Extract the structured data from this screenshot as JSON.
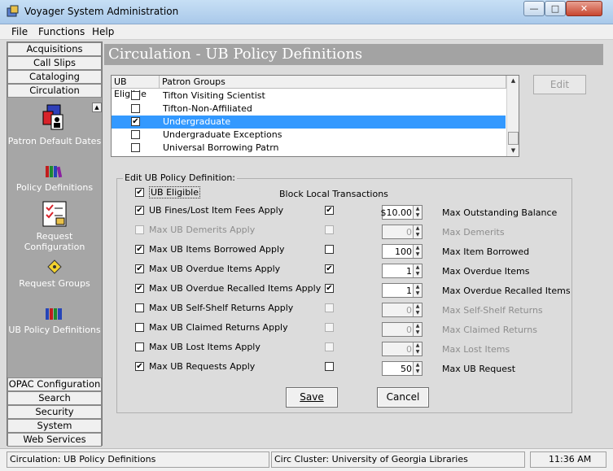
{
  "window": {
    "title": "Voyager System Administration"
  },
  "menu": [
    "File",
    "Functions",
    "Help"
  ],
  "nav": {
    "top_buttons": [
      "Acquisitions",
      "Call Slips",
      "Cataloging",
      "Circulation"
    ],
    "icon_items": [
      {
        "label": "Patron Default Dates",
        "icon": "patron-dates-icon"
      },
      {
        "label": "Policy Definitions",
        "icon": "books-icon"
      },
      {
        "label": "Request Configuration",
        "icon": "checklist-icon"
      },
      {
        "label": "Request Groups",
        "icon": "diamond-icon"
      },
      {
        "label": "UB Policy Definitions",
        "icon": "ub-books-icon"
      }
    ],
    "bottom_buttons": [
      "OPAC Configuration",
      "Search",
      "Security",
      "System",
      "Web Services"
    ]
  },
  "page": {
    "title": "Circulation - UB Policy Definitions"
  },
  "patron_list": {
    "headers": [
      "UB Eligible",
      "Patron Groups"
    ],
    "rows": [
      {
        "eligible": false,
        "name": "Tifton Visiting Scientist",
        "selected": false
      },
      {
        "eligible": false,
        "name": "Tifton-Non-Affiliated",
        "selected": false
      },
      {
        "eligible": true,
        "name": "Undergraduate",
        "selected": true
      },
      {
        "eligible": false,
        "name": "Undergraduate Exceptions",
        "selected": false
      },
      {
        "eligible": false,
        "name": "Universal Borrowing Patrn",
        "selected": false
      }
    ]
  },
  "edit_button": "Edit",
  "form": {
    "group_label": "Edit UB Policy Definition:",
    "ub_eligible_label": "UB Eligible",
    "ub_eligible_checked": true,
    "block_header": "Block Local Transactions",
    "rows": [
      {
        "label": "UB Fines/Lost Item Fees Apply",
        "apply": true,
        "enabled": true,
        "block": true,
        "value": "$10.00",
        "limit_label": "Max Outstanding Balance"
      },
      {
        "label": "Max UB Demerits Apply",
        "apply": false,
        "enabled": false,
        "block": false,
        "value": "0",
        "limit_label": "Max Demerits"
      },
      {
        "label": "Max UB Items Borrowed Apply",
        "apply": true,
        "enabled": true,
        "block": false,
        "value": "100",
        "limit_label": "Max Item Borrowed"
      },
      {
        "label": "Max UB Overdue Items Apply",
        "apply": true,
        "enabled": true,
        "block": true,
        "value": "1",
        "limit_label": "Max Overdue Items"
      },
      {
        "label": "Max UB Overdue Recalled Items Apply",
        "apply": true,
        "enabled": true,
        "block": true,
        "value": "1",
        "limit_label": "Max Overdue Recalled Items"
      },
      {
        "label": "Max UB Self-Shelf Returns Apply",
        "apply": false,
        "enabled": true,
        "block": false,
        "value": "0",
        "limit_label": "Max Self-Shelf Returns"
      },
      {
        "label": "Max UB Claimed Returns Apply",
        "apply": false,
        "enabled": true,
        "block": false,
        "value": "0",
        "limit_label": "Max Claimed Returns"
      },
      {
        "label": "Max UB Lost Items Apply",
        "apply": false,
        "enabled": true,
        "block": false,
        "value": "0",
        "limit_label": "Max Lost Items"
      },
      {
        "label": "Max UB Requests Apply",
        "apply": true,
        "enabled": true,
        "block": false,
        "value": "50",
        "limit_label": "Max UB Request"
      }
    ],
    "save_label": "Save",
    "cancel_label": "Cancel"
  },
  "status": {
    "left": "Circulation:  UB Policy Definitions",
    "middle": "Circ Cluster:  University of Georgia Libraries",
    "time": "11:36 AM"
  }
}
